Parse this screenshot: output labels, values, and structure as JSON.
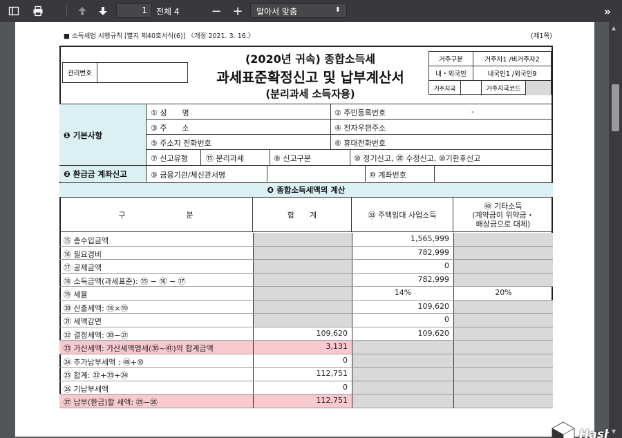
{
  "toolbar": {
    "page_number": "1",
    "page_total": "전체 4",
    "zoom_option": "알아서 맞춤",
    "minus": "−",
    "plus": "+"
  },
  "header": {
    "legal_ref": "■ 소득세법 시행규칙 [별지 제40호서식(6)] 〈개정 2021. 3. 16.〉",
    "page_info": "(제1쪽)",
    "mgmt_label": "관리번호",
    "title_line1": "(2020년 귀속) 종합소득세",
    "title_line2": "과세표준확정신고 및 납부계산서",
    "title_line3": "(분리과세 소득자용)",
    "res_type_label": "거주구분",
    "res_type_value": "거주자1 /비거주자2",
    "nationality_label": "내・외국인",
    "nationality_value": "내국인1 /외국인9",
    "country_label": "거주지국",
    "country_code_label": "거주지국코드"
  },
  "basic": {
    "section": "❶ 기본사항",
    "name": "① 성　　명",
    "rrn": "② 주민등록번호",
    "rrn_value": "-",
    "address": "③ 주　　소",
    "email": "④ 전자우편주소",
    "phone": "⑤ 주소지 전화번호",
    "mobile": "⑥ 휴대전화번호",
    "report_type": "⑦ 신고유형",
    "separate_tax": "⑮ 분리과세",
    "report_kind": "⑧ 신고구분",
    "report_options": "⑩ 정기신고, ⑳ 수정신고, ⑩기한후신고"
  },
  "refund": {
    "section": "❷ 환급금 계좌신고",
    "bank": "⑨ 금융기관/체신관서명",
    "account": "⑩ 계좌번호"
  },
  "calc": {
    "section": "❹ 종합소득세액의 계산",
    "col_item": "구　　　　　　　　분",
    "col_total": "합　　계",
    "col_rental": "㉝ 주택임대 사업소득",
    "col_other_1": "㊾ 기타소득",
    "col_other_2": "(계약금이 위약금・",
    "col_other_3": "배상금으로 대체)",
    "rows": [
      {
        "label": "⑮ 총수입금액",
        "total": "",
        "rental": "1,565,999",
        "other": ""
      },
      {
        "label": "⑯ 필요경비",
        "total": "",
        "rental": "782,999",
        "other": ""
      },
      {
        "label": "⑰ 공제금액",
        "total": "",
        "rental": "0",
        "other": ""
      },
      {
        "label": "⑱ 소득금액(과세표준): ⑮ − ⑯ − ⑰",
        "total": "",
        "rental": "782,999",
        "other": ""
      },
      {
        "label": "⑲ 세율",
        "total": "",
        "rental": "14%",
        "other": "20%"
      },
      {
        "label": "⑳ 산출세액: ⑱×⑲",
        "total": "",
        "rental": "109,620",
        "other": ""
      },
      {
        "label": "㉑ 세액감면",
        "total": "",
        "rental": "0",
        "other": ""
      },
      {
        "label": "㉒ 결정세액: ⑳−㉑",
        "total": "109,620",
        "rental": "109,620",
        "other": ""
      },
      {
        "label": "㉓ 가산세액: 가산세액명세(㊱~㊶)의 합계금액",
        "total": "3,131",
        "rental": "",
        "other": ""
      },
      {
        "label": "㉔ 추가납부세액 : ㊾+⑩",
        "total": "0",
        "rental": "",
        "other": ""
      },
      {
        "label": "㉕ 합계: ㉒+㉓+㉔",
        "total": "112,751",
        "rental": "",
        "other": ""
      },
      {
        "label": "㉖ 기납부세액",
        "total": "0",
        "rental": "",
        "other": ""
      },
      {
        "label": "㉗ 납부(환급)할 세액: ㉕−㉖",
        "total": "112,751",
        "rental": "",
        "other": ""
      }
    ]
  },
  "watermark": {
    "text": "HashTag"
  },
  "colors": {
    "section_bg": "#daf0f2",
    "highlight": "#f8c9cf",
    "gray_cell": "#d9d9d9",
    "toolbar": "#38383d"
  }
}
